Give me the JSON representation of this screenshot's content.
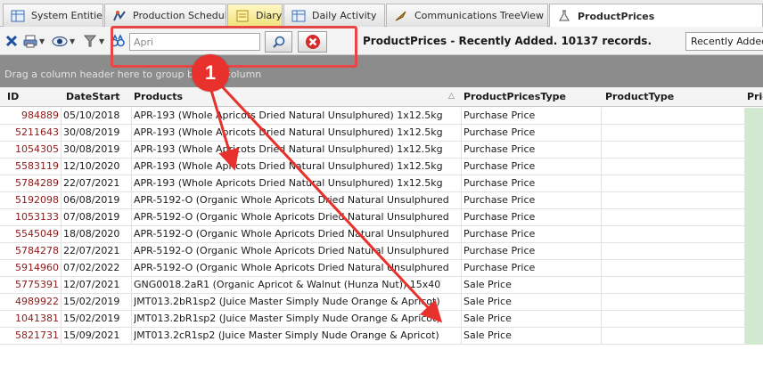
{
  "tabs": [
    {
      "label": "System Entities",
      "icon": "grid-icon"
    },
    {
      "label": "Production Scheduler",
      "icon": "scheduler-icon"
    },
    {
      "label": "Diary",
      "icon": "diary-icon"
    },
    {
      "label": "Daily Activity",
      "icon": "grid-icon"
    },
    {
      "label": "Communications TreeView",
      "icon": "treeview-icon"
    },
    {
      "label": "ProductPrices",
      "icon": "flask-icon"
    }
  ],
  "toolbar": {
    "search_value": "Apri",
    "record_status": "ProductPrices - Recently Added. 10137 records.",
    "view_selected": "Recently Added"
  },
  "group_panel": {
    "hint": "Drag a column header here to group by that column"
  },
  "grid": {
    "columns": [
      "ID",
      "DateStart",
      "Products",
      "ProductPricesType",
      "ProductType",
      "Pric"
    ],
    "rows": [
      {
        "id": "984889",
        "date": "05/10/2018",
        "product": "APR-193 (Whole Apricots Dried Natural Unsulphured) 1x12.5kg",
        "type": "Purchase Price"
      },
      {
        "id": "5211643",
        "date": "30/08/2019",
        "product": "APR-193 (Whole Apricots Dried Natural Unsulphured) 1x12.5kg",
        "type": "Purchase Price"
      },
      {
        "id": "1054305",
        "date": "30/08/2019",
        "product": "APR-193 (Whole Apricots Dried Natural Unsulphured) 1x12.5kg",
        "type": "Purchase Price"
      },
      {
        "id": "5583119",
        "date": "12/10/2020",
        "product": "APR-193 (Whole Apricots Dried Natural Unsulphured) 1x12.5kg",
        "type": "Purchase Price"
      },
      {
        "id": "5784289",
        "date": "22/07/2021",
        "product": "APR-193 (Whole Apricots Dried Natural Unsulphured) 1x12.5kg",
        "type": "Purchase Price"
      },
      {
        "id": "5192098",
        "date": "06/08/2019",
        "product": "APR-5192-O (Organic Whole Apricots Dried Natural Unsulphured",
        "type": "Purchase Price"
      },
      {
        "id": "1053133",
        "date": "07/08/2019",
        "product": "APR-5192-O (Organic Whole Apricots Dried Natural Unsulphured",
        "type": "Purchase Price"
      },
      {
        "id": "5545049",
        "date": "18/08/2020",
        "product": "APR-5192-O (Organic Whole Apricots Dried Natural Unsulphured",
        "type": "Purchase Price"
      },
      {
        "id": "5784278",
        "date": "22/07/2021",
        "product": "APR-5192-O (Organic Whole Apricots Dried Natural Unsulphured",
        "type": "Purchase Price"
      },
      {
        "id": "5914960",
        "date": "07/02/2022",
        "product": "APR-5192-O (Organic Whole Apricots Dried Natural Unsulphured",
        "type": "Purchase Price"
      },
      {
        "id": "5775391",
        "date": "12/07/2021",
        "product": "GNG0018.2aR1 (Organic Apricot & Walnut (Hunza Nut)) 15x40",
        "type": "Sale Price"
      },
      {
        "id": "4989922",
        "date": "15/02/2019",
        "product": "JMT013.2bR1sp2 (Juice Master Simply Nude Orange & Apricot)",
        "type": "Sale Price"
      },
      {
        "id": "1041381",
        "date": "15/02/2019",
        "product": "JMT013.2bR1sp2 (Juice Master Simply Nude Orange & Apricot)",
        "type": "Sale Price"
      },
      {
        "id": "5821731",
        "date": "15/09/2021",
        "product": "JMT013.2cR1sp2 (Juice Master Simply Nude Orange & Apricot)",
        "type": "Sale Price"
      }
    ]
  },
  "annotation": {
    "badge": "1"
  },
  "colors": {
    "accent_red": "#e8302c",
    "price_column": "#d3e8d0",
    "id_text": "#8b1a1a"
  }
}
